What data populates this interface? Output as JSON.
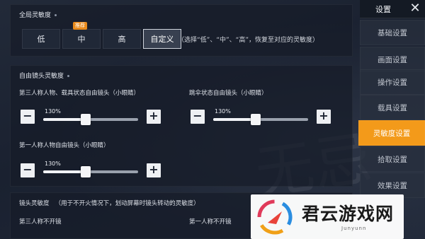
{
  "global": {
    "title": "全局灵敏度",
    "options": [
      "低",
      "中",
      "高",
      "自定义"
    ],
    "selected": "自定义",
    "badge": "推荐",
    "hint": "（选择“低”、“中”、“高”，恢复至对应的灵敏度）"
  },
  "free_camera": {
    "title": "自由镜头灵敏度",
    "sliders": [
      {
        "label": "第三人称人物、载具状态自由镜头（小眼睛）",
        "value_text": "130%",
        "level": 0.45
      },
      {
        "label": "跳伞状态自由镜头（小眼睛）",
        "value_text": "130%",
        "level": 0.45
      },
      {
        "label": "第一人称人物自由镜头（小眼睛）",
        "value_text": "130%",
        "level": 0.45
      }
    ],
    "minus": "−",
    "plus": "+"
  },
  "camera": {
    "title": "镜头灵敏度",
    "note": "（用于不开火情况下，划动屏幕时镜头转动的灵敏度）",
    "third_person": "第三人称不开镜",
    "first_person": "第一人称不开镜"
  },
  "sidebar": {
    "title": "设置",
    "close": "✕",
    "items": [
      "基础设置",
      "画面设置",
      "操作设置",
      "载具设置",
      "灵敏度设置",
      "拾取设置",
      "效果设置"
    ],
    "active": "灵敏度设置",
    "active_color": "#f39a1a"
  },
  "watermark": {
    "text": "君云游戏网",
    "sub": "Junyunn"
  }
}
